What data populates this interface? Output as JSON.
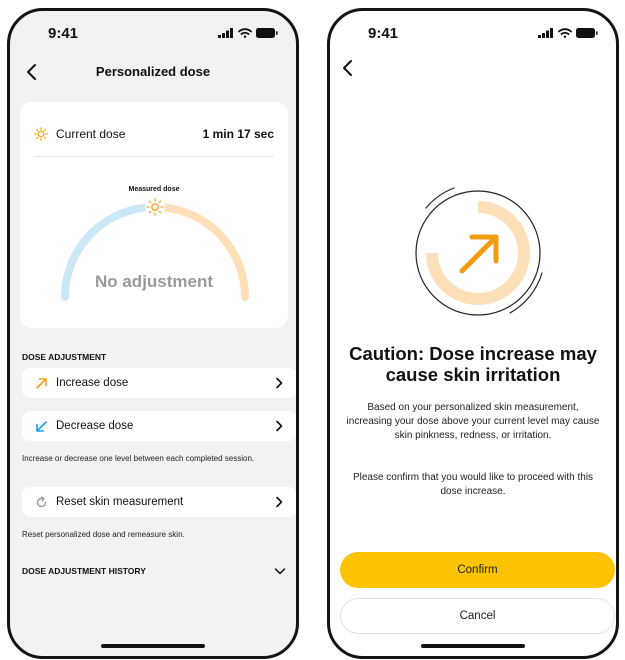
{
  "left_screen": {
    "status_bar": {
      "time": "9:41"
    },
    "nav": {
      "title": "Personalized dose"
    },
    "dose_card": {
      "current_dose_label": "Current dose",
      "current_dose_value": "1 min 17 sec",
      "gauge_label": "Measured dose",
      "gauge_center_text": "No adjustment"
    },
    "dose_adjustment": {
      "header": "DOSE ADJUSTMENT",
      "increase_label": "Increase dose",
      "decrease_label": "Decrease dose",
      "hint": "Increase or decrease one level between each completed session.",
      "reset_label": "Reset skin measurement",
      "reset_hint": "Reset personalized dose and remeasure skin."
    },
    "history": {
      "header": "DOSE ADJUSTMENT HISTORY"
    }
  },
  "right_screen": {
    "status_bar": {
      "time": "9:41"
    },
    "caution": {
      "title": "Caution: Dose increase may cause skin irritation",
      "body": "Based on your personalized skin measurement, increasing your dose above your current level may cause skin pinkness, redness, or irritation.",
      "confirm_prompt": "Please confirm that you would like to proceed with this dose increase."
    },
    "buttons": {
      "confirm": "Confirm",
      "cancel": "Cancel"
    }
  },
  "colors": {
    "accent_yellow": "#fcc303",
    "sun_orange": "#f5a623",
    "increase_orange": "#f39c12",
    "decrease_blue": "#1aa3e8",
    "gauge_blue": "#cce7f6",
    "gauge_peach": "#fde0b8",
    "screen_background": "#f2f2f4"
  },
  "icons": {
    "back": "chevron-left-icon",
    "sun": "sun-icon",
    "increase": "arrow-up-right-icon",
    "decrease": "arrow-down-left-icon",
    "reset": "refresh-icon",
    "row_chevron": "chevron-right-icon",
    "history_chevron": "chevron-down-icon"
  }
}
